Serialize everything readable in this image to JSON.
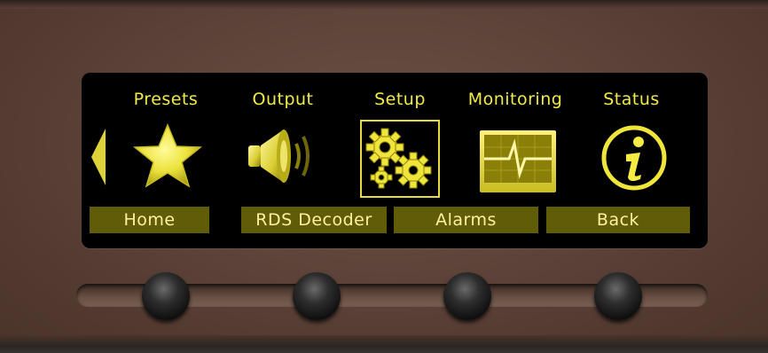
{
  "menu": {
    "items": [
      {
        "label": "Presets",
        "icon": "star-icon"
      },
      {
        "label": "Output",
        "icon": "speaker-icon"
      },
      {
        "label": "Setup",
        "icon": "gears-icon",
        "selected": true
      },
      {
        "label": "Monitoring",
        "icon": "waveform-monitor-icon"
      },
      {
        "label": "Status",
        "icon": "info-icon"
      }
    ]
  },
  "softkeys": [
    "Home",
    "RDS Decoder",
    "Alarms",
    "Back"
  ],
  "colors": {
    "accent_yellow": "#f1ea4a",
    "softkey_bg": "#615c07",
    "softkey_text": "#fff0a0",
    "panel": "#5a4036",
    "screen": "#000000"
  }
}
